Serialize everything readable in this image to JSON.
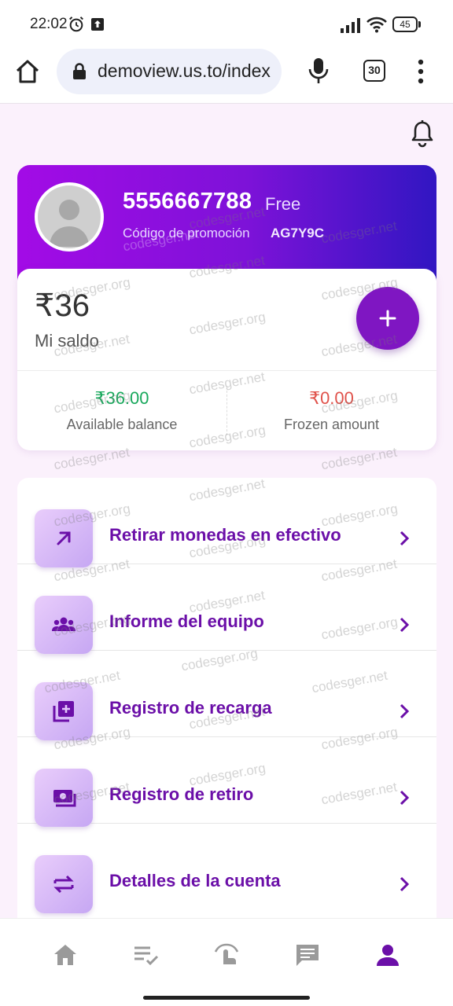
{
  "status_bar": {
    "time": "22:02",
    "battery": "45",
    "icons": [
      "alarm-icon",
      "upload-icon",
      "signal-icon",
      "wifi-icon",
      "battery-icon"
    ]
  },
  "browser": {
    "url": "demoview.us.to/index",
    "tab_count": "30",
    "icons": [
      "home-icon",
      "lock-icon",
      "microphone-icon",
      "tabs-icon",
      "more-menu-icon"
    ]
  },
  "profile": {
    "phone": "5556667788",
    "plan": "Free",
    "promo_label": "Código de promoción",
    "promo_code": "AG7Y9C"
  },
  "balance": {
    "amount": "₹36",
    "label": "Mi saldo",
    "available_value": "₹36.00",
    "available_label": "Available balance",
    "frozen_value": "₹0.00",
    "frozen_label": "Frozen amount"
  },
  "menu": {
    "items": [
      {
        "label": "Retirar monedas en efectivo",
        "icon": "arrow-up-right-icon"
      },
      {
        "label": "Informe del equipo",
        "icon": "group-icon"
      },
      {
        "label": "Registro de recarga",
        "icon": "add-box-icon"
      },
      {
        "label": "Registro de retiro",
        "icon": "cash-icon"
      },
      {
        "label": "Detalles de la cuenta",
        "icon": "swap-icon"
      }
    ]
  },
  "watermark": "codesger.net",
  "watermark_alt": "codesger.org",
  "bottom_nav": {
    "items": [
      "home-icon",
      "tasks-icon",
      "touch-icon",
      "chat-icon",
      "person-icon"
    ],
    "active": "person-icon"
  },
  "colors": {
    "accent": "#6b0fa8",
    "gradient_start": "#a30be6",
    "gradient_end": "#3116c2",
    "available": "#19a85c",
    "frozen": "#e0514a"
  }
}
